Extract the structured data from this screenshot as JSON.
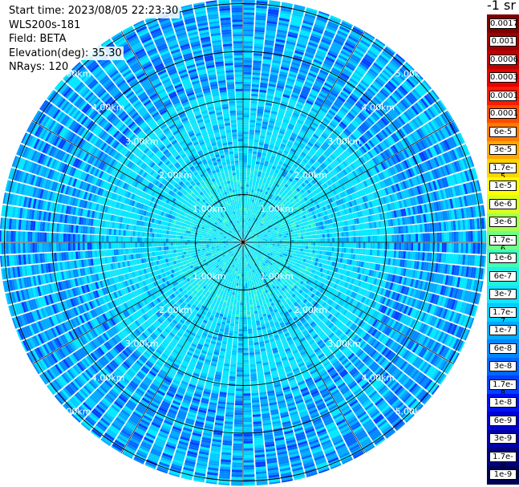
{
  "info": {
    "start_time": "Start time: 2023/08/05 22:23:30",
    "instrument": "WLS200s-181",
    "field": "Field: BETA",
    "elevation": "Elevation(deg): 35.30",
    "nrays": "NRays: 120"
  },
  "colorbar": {
    "unit_label": "-1 sr",
    "levels": [
      {
        "label": "0.0017",
        "color": "#7f0000"
      },
      {
        "label": "0.001",
        "color": "#a00000"
      },
      {
        "label": "0.0006",
        "color": "#c00000"
      },
      {
        "label": "0.0003",
        "color": "#e60000"
      },
      {
        "label": "0.00017",
        "color": "#ff1a00"
      },
      {
        "label": "0.0001",
        "color": "#ff4a00"
      },
      {
        "label": "6e-5",
        "color": "#ff7a00"
      },
      {
        "label": "3e-5",
        "color": "#ffa800"
      },
      {
        "label": "1.7e-5",
        "color": "#ffd400"
      },
      {
        "label": "1e-5",
        "color": "#ffff00"
      },
      {
        "label": "6e-6",
        "color": "#d8ff20"
      },
      {
        "label": "3e-6",
        "color": "#a6ff50"
      },
      {
        "label": "1.7e-6",
        "color": "#70ff86"
      },
      {
        "label": "1e-6",
        "color": "#40ffb8"
      },
      {
        "label": "6e-7",
        "color": "#20f0e0"
      },
      {
        "label": "3e-7",
        "color": "#14e4ff"
      },
      {
        "label": "1.7e-7",
        "color": "#00ccff"
      },
      {
        "label": "1e-7",
        "color": "#00aaff"
      },
      {
        "label": "6e-8",
        "color": "#0088ff"
      },
      {
        "label": "3e-8",
        "color": "#0066ff"
      },
      {
        "label": "1.7e-8",
        "color": "#0040ff"
      },
      {
        "label": "1e-8",
        "color": "#0010f0"
      },
      {
        "label": "6e-9",
        "color": "#0000d0"
      },
      {
        "label": "3e-9",
        "color": "#0000a8"
      },
      {
        "label": "1.7e-9",
        "color": "#000080"
      },
      {
        "label": "1e-9",
        "color": "#000050"
      }
    ]
  },
  "chart_data": {
    "type": "heatmap",
    "subtype": "polar-ppi",
    "title": "",
    "field": "BETA",
    "nrays": 120,
    "range_rings": [
      {
        "radius_km": 1,
        "label": "1.00km"
      },
      {
        "radius_km": 2,
        "label": "2.00km"
      },
      {
        "radius_km": 3,
        "label": "3.00km"
      },
      {
        "radius_km": 4,
        "label": "4.00km"
      },
      {
        "radius_km": 5,
        "label": "5.00km"
      }
    ],
    "max_range_km": 5.1,
    "spoke_azimuths_deg": [
      0,
      30,
      60,
      90,
      120,
      150,
      180,
      210,
      240,
      270,
      300,
      330
    ],
    "label_bearings_deg": [
      45,
      135,
      225,
      315
    ],
    "range_gate_km": 0.05,
    "value_description": "backscatter mostly 1.7e-8 to 3e-7 sr-1; outer ranges ~1e-8 to 6e-8"
  }
}
